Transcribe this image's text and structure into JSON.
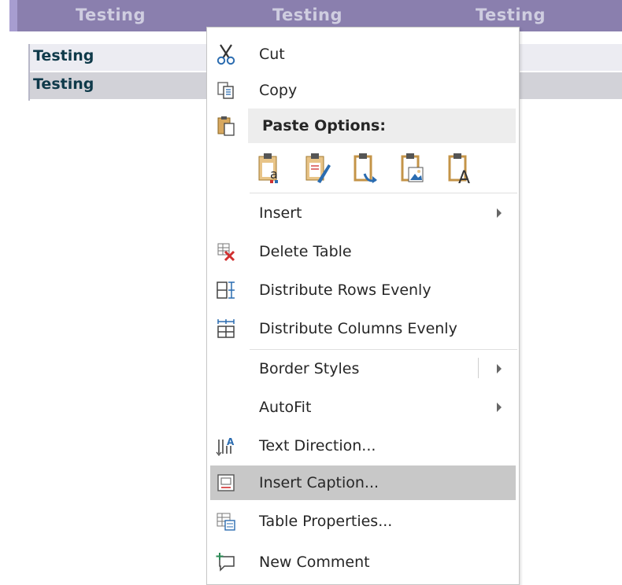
{
  "table": {
    "headers": [
      "Testing",
      "Testing",
      "Testing"
    ],
    "rows": [
      "Testing",
      "Testing"
    ]
  },
  "menu": {
    "cut": "Cut",
    "copy": "Copy",
    "paste_options": "Paste Options:",
    "insert": "Insert",
    "delete_table": "Delete Table",
    "distribute_rows": "Distribute Rows Evenly",
    "distribute_columns": "Distribute Columns Evenly",
    "border_styles": "Border Styles",
    "autofit": "AutoFit",
    "text_direction": "Text Direction...",
    "insert_caption": "Insert Caption...",
    "table_properties": "Table Properties...",
    "new_comment": "New Comment"
  },
  "paste_buttons": [
    {
      "icon": "paste-keep-formatting-icon"
    },
    {
      "icon": "paste-merge-formatting-icon"
    },
    {
      "icon": "paste-nest-table-icon"
    },
    {
      "icon": "paste-picture-icon"
    },
    {
      "icon": "paste-text-only-icon"
    }
  ],
  "colors": {
    "header_bg": "#8a7fae",
    "highlight": "#c8c8c8"
  }
}
